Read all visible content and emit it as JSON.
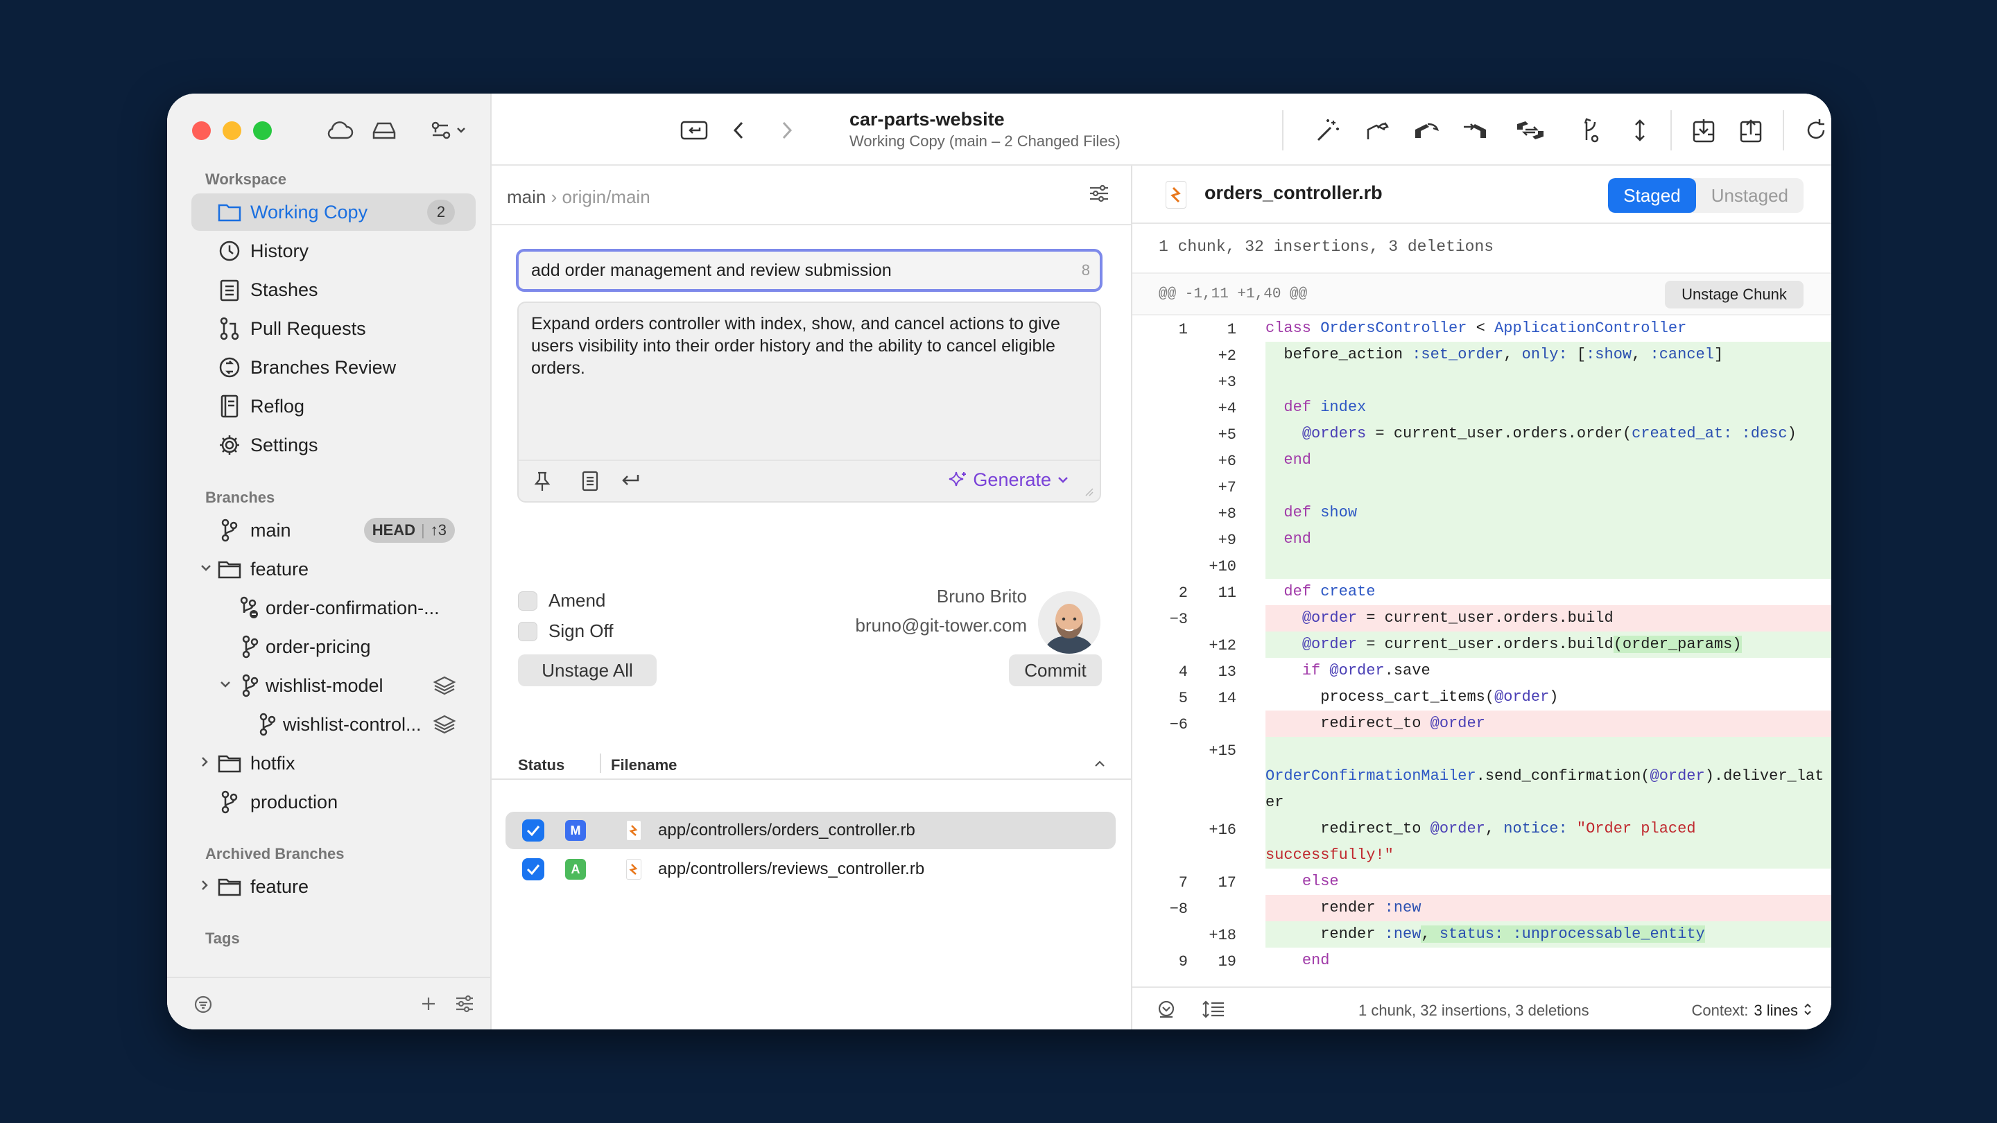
{
  "colors": {
    "accent": "#1a74f0",
    "generate": "#7a42d8",
    "add_bg": "#e6f7e4",
    "del_bg": "#fde6e6"
  },
  "window": {
    "repo_name": "car-parts-website",
    "subtitle": "Working Copy (main – 2 Changed Files)"
  },
  "sidebar": {
    "workspace_title": "Workspace",
    "items": [
      {
        "label": "Working Copy",
        "count": "2",
        "icon": "folder-icon"
      },
      {
        "label": "History",
        "icon": "clock-icon"
      },
      {
        "label": "Stashes",
        "icon": "clipboard-icon"
      },
      {
        "label": "Pull Requests",
        "icon": "pull-request-icon"
      },
      {
        "label": "Branches Review",
        "icon": "review-icon"
      },
      {
        "label": "Reflog",
        "icon": "notebook-icon"
      },
      {
        "label": "Settings",
        "icon": "gear-icon"
      }
    ],
    "branches_title": "Branches",
    "branches": [
      {
        "label": "main",
        "badge_head": "HEAD",
        "badge_ahead": "↑3"
      },
      {
        "label": "feature"
      },
      {
        "label": "order-confirmation-..."
      },
      {
        "label": "order-pricing"
      },
      {
        "label": "wishlist-model"
      },
      {
        "label": "wishlist-control..."
      },
      {
        "label": "hotfix"
      },
      {
        "label": "production"
      }
    ],
    "archived_title": "Archived Branches",
    "archived": [
      {
        "label": "feature"
      }
    ],
    "tags_title": "Tags"
  },
  "commit": {
    "branch": "main",
    "remote": "origin/main",
    "subject": "add order management and review submission",
    "subject_count": "8",
    "body": "Expand orders controller with index, show, and cancel actions to give users visibility into their order history and the ability to cancel eligible orders.",
    "generate_label": "Generate",
    "amend_label": "Amend",
    "signoff_label": "Sign Off",
    "author_name": "Bruno Brito",
    "author_email": "bruno@git-tower.com",
    "unstage_all": "Unstage All",
    "commit_label": "Commit"
  },
  "files": {
    "col_status": "Status",
    "col_filename": "Filename",
    "rows": [
      {
        "status": "M",
        "status_color": "#3b6ff0",
        "path": "app/controllers/orders_controller.rb"
      },
      {
        "status": "A",
        "status_color": "#4cba5b",
        "path": "app/controllers/reviews_controller.rb"
      }
    ]
  },
  "diff": {
    "filename": "orders_controller.rb",
    "staged": "Staged",
    "unstaged": "Unstaged",
    "stats": "1 chunk, 32 insertions, 3 deletions",
    "hunk_header": "@@ -1,11 +1,40 @@",
    "unstage_chunk": "Unstage Chunk",
    "footer_stats": "1 chunk, 32 insertions, 3 deletions",
    "context_label": "Context:",
    "context_value": "3 lines"
  }
}
